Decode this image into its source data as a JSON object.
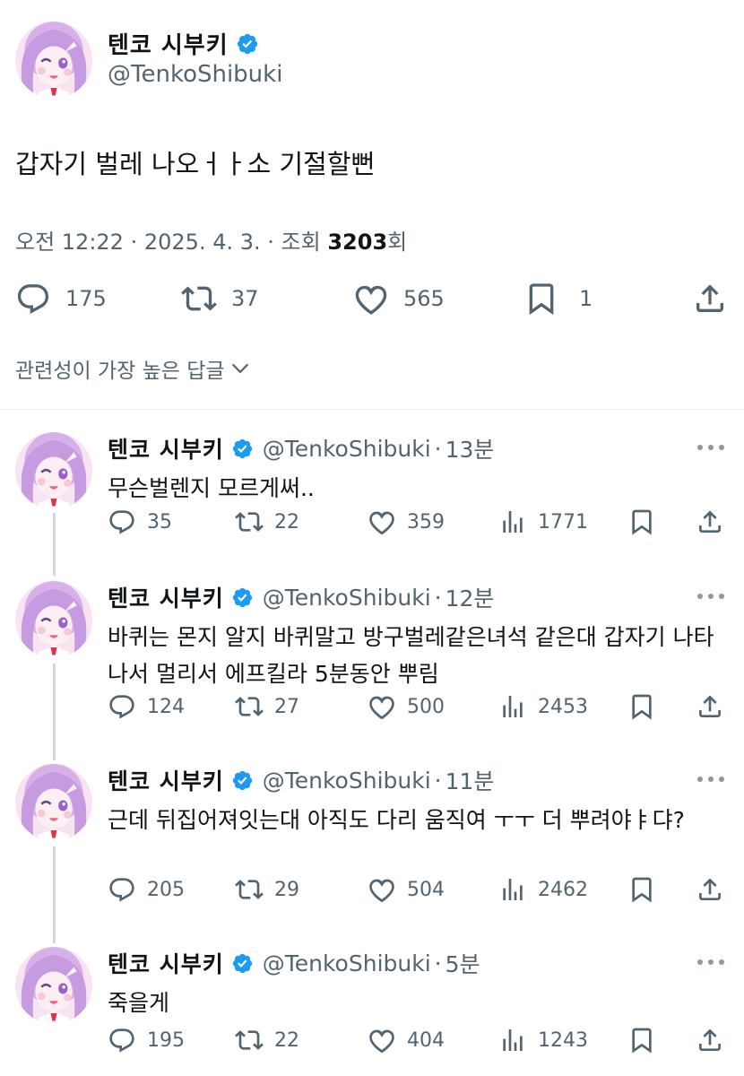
{
  "main_tweet": {
    "display_name": "텐코 시부키",
    "handle": "@TenkoShibuki",
    "text": "갑자기 벌레 나오ㅓㅏ소 기절할뻔",
    "time": "오전 12:22",
    "date": "2025. 4. 3.",
    "views_prefix": "조회",
    "views": "3203",
    "views_suffix": "회",
    "replies": "175",
    "retweets": "37",
    "likes": "565",
    "bookmarks": "1"
  },
  "sort_label": "관련성이 가장 높은 답글",
  "replies": [
    {
      "display_name": "텐코 시부키",
      "handle": "@TenkoShibuki",
      "time": "13분",
      "text": "무슨벌렌지 모르게써..",
      "replies": "35",
      "retweets": "22",
      "likes": "359",
      "views": "1771"
    },
    {
      "display_name": "텐코 시부키",
      "handle": "@TenkoShibuki",
      "time": "12분",
      "text": "바퀴는 몬지 알지 바퀴말고 방구벌레같은녀석 같은대 갑자기 나타나서 멀리서 에프킬라 5분동안 뿌림",
      "replies": "124",
      "retweets": "27",
      "likes": "500",
      "views": "2453"
    },
    {
      "display_name": "텐코 시부키",
      "handle": "@TenkoShibuki",
      "time": "11분",
      "text": "근데 뒤집어져잇는대 아직도 다리 움직여 ㅜㅜ 더 뿌려야ㅑ댜?",
      "replies": "205",
      "retweets": "29",
      "likes": "504",
      "views": "2462"
    },
    {
      "display_name": "텐코 시부키",
      "handle": "@TenkoShibuki",
      "time": "5분",
      "text": "죽을게",
      "replies": "195",
      "retweets": "22",
      "likes": "404",
      "views": "1243"
    }
  ],
  "icons": {
    "verified": "verified-badge-icon",
    "reply": "reply-icon",
    "retweet": "retweet-icon",
    "like": "heart-icon",
    "views": "views-icon",
    "bookmark": "bookmark-icon",
    "share": "share-icon",
    "more": "more-icon",
    "chevron": "chevron-down-icon"
  },
  "colors": {
    "text": "#0f1419",
    "secondary": "#536471",
    "verified": "#1d9bf0",
    "thread_line": "#cfd9de",
    "avatar_bg": "#f3d6ee",
    "avatar_hair": "#c79be0"
  }
}
